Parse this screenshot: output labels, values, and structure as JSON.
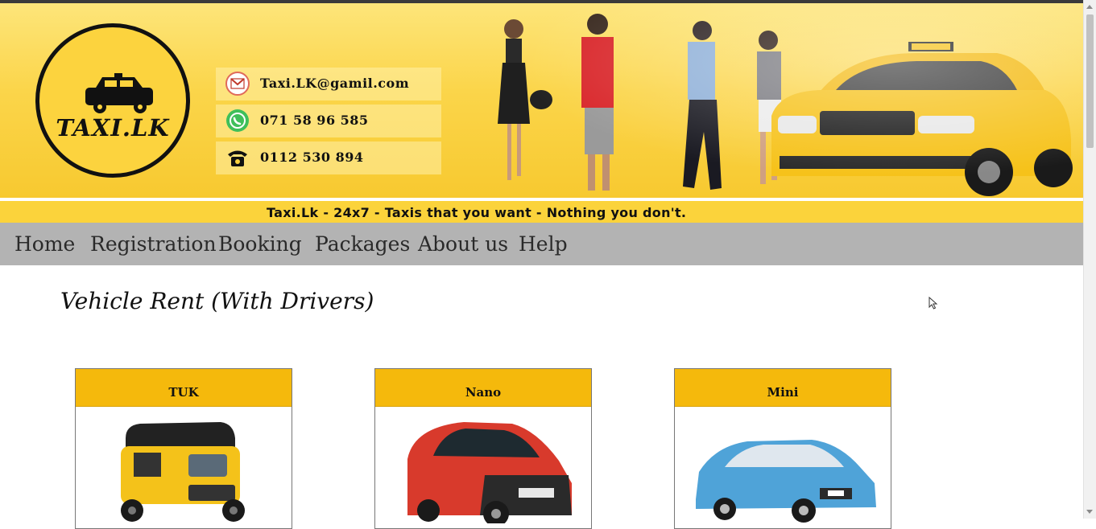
{
  "header": {
    "logo_text": "TAXI.LK",
    "contacts": [
      {
        "icon": "gmail-icon",
        "text": "Taxi.LK@gamil.com"
      },
      {
        "icon": "whatsapp-icon",
        "text": "071 58 96 585"
      },
      {
        "icon": "telephone-icon",
        "text": "0112 530 894"
      }
    ],
    "tagline": "Taxi.Lk - 24x7 - Taxis that you want - Nothing you don't."
  },
  "nav": {
    "items": [
      "Home",
      "Registration",
      "Booking",
      "Packages",
      "About us",
      "Help"
    ]
  },
  "main": {
    "title": "Vehicle Rent (With Drivers)",
    "cards": [
      {
        "name": "TUK",
        "image": "tuk-tuk-image"
      },
      {
        "name": "Nano",
        "image": "nano-car-image"
      },
      {
        "name": "Mini",
        "image": "mini-car-image"
      }
    ]
  },
  "colors": {
    "banner_yellow": "#fbd54a",
    "card_header": "#f5b90c",
    "nav_bg": "#b3b3b3"
  }
}
